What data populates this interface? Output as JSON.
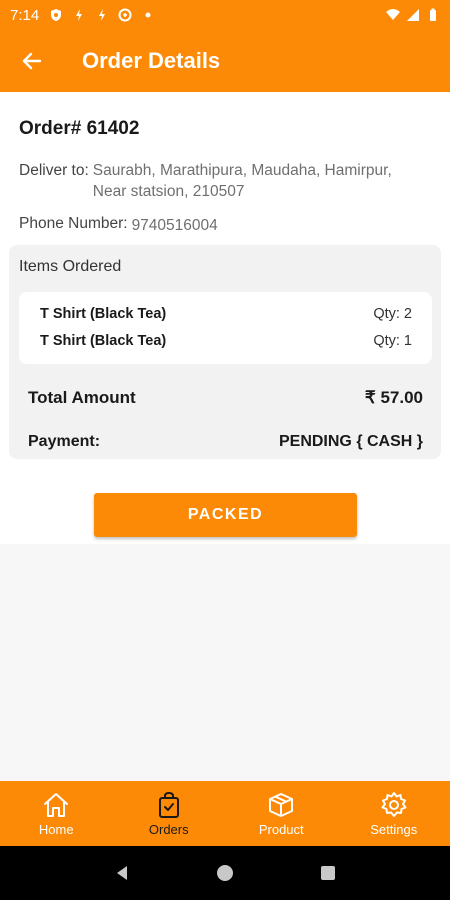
{
  "status_bar": {
    "time": "7:14"
  },
  "app_bar": {
    "title": "Order Details"
  },
  "order": {
    "number": "Order# 61402",
    "deliver_label": "Deliver to:",
    "deliver_value": "Saurabh, Marathipura, Maudaha, Hamirpur, Near statsion, 210507",
    "phone_label": "Phone Number:",
    "phone_value": "9740516004"
  },
  "items": {
    "title": "Items Ordered",
    "list": [
      {
        "name": "T Shirt (Black Tea)",
        "qty": "Qty:  2"
      },
      {
        "name": "T Shirt (Black Tea)",
        "qty": "Qty:  1"
      }
    ],
    "total_label": "Total Amount",
    "total_value": "₹ 57.00",
    "payment_label": "Payment:",
    "payment_value": "PENDING { CASH }"
  },
  "action": {
    "packed_label": "PACKED"
  },
  "bottom_nav": [
    {
      "label": "Home",
      "icon": "home-icon"
    },
    {
      "label": "Orders",
      "icon": "orders-icon",
      "active": true
    },
    {
      "label": "Product",
      "icon": "product-icon"
    },
    {
      "label": "Settings",
      "icon": "settings-icon"
    }
  ],
  "colors": {
    "accent": "#fd8a06",
    "background": "#f7f7f7",
    "card": "#f2f2f2"
  }
}
